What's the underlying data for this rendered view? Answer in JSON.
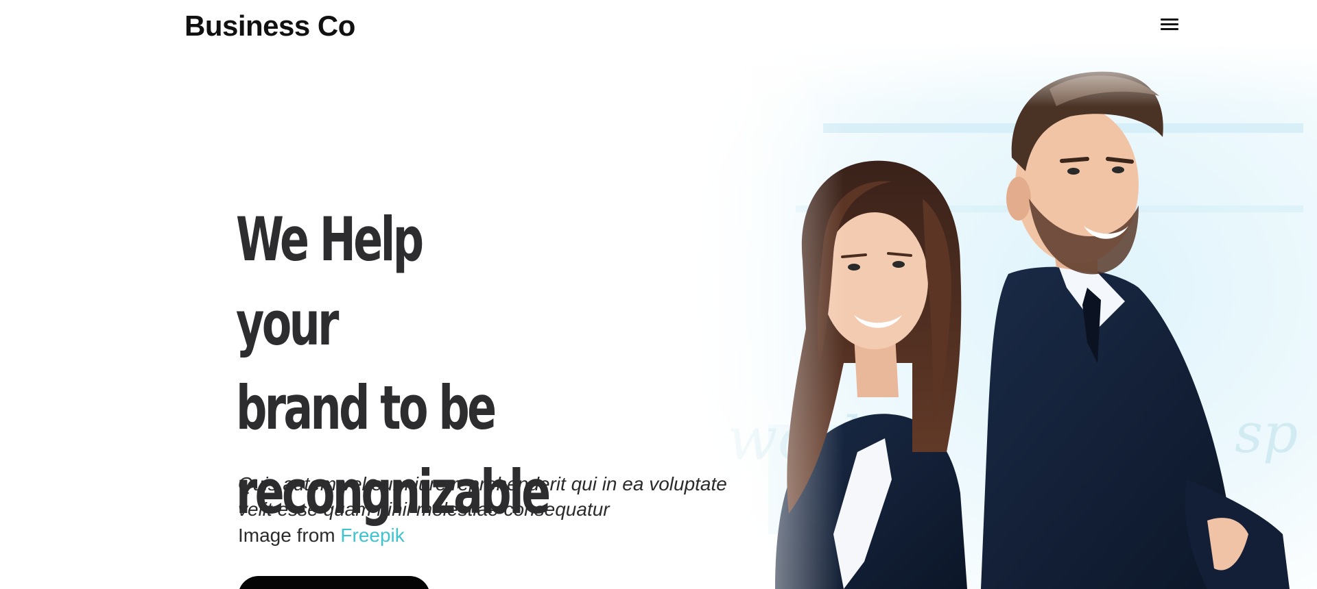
{
  "header": {
    "brand": "Business Co",
    "menu_icon": "hamburger-menu-icon"
  },
  "hero": {
    "title_lines": [
      "We Help your",
      "brand to be",
      "recongnizable"
    ],
    "description": "Quis autem vel eum iure reprehenderit qui in ea voluptate velit esse quam nihil molestiae consequatur",
    "credit_prefix": "Image from",
    "credit_link": "Freepik",
    "accent_color": "#3ec3cf",
    "photo": "two-business-people-back-to-back-photo"
  }
}
